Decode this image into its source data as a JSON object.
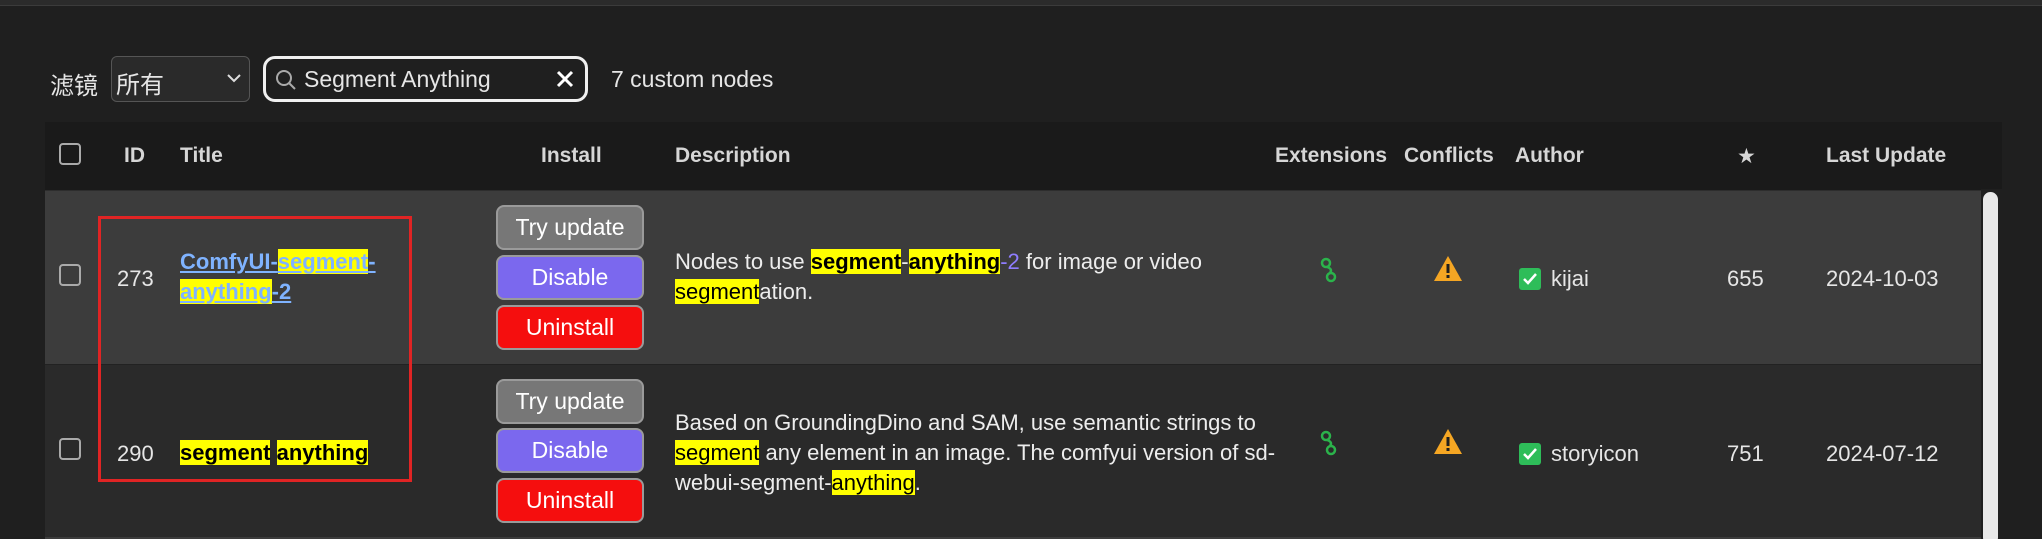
{
  "filter": {
    "label": "滤镜",
    "selected": "所有",
    "search_value": "Segment Anything",
    "count_text": "7 custom nodes"
  },
  "headers": {
    "id": "ID",
    "title": "Title",
    "install": "Install",
    "description": "Description",
    "extensions": "Extensions",
    "conflicts": "Conflicts",
    "author": "Author",
    "stars": "★",
    "last_update": "Last Update"
  },
  "rows": [
    {
      "id": "273",
      "title_parts": [
        "ComfyUI-",
        "segment",
        "-",
        "anything",
        "-2"
      ],
      "buttons": [
        "Try update",
        "Disable",
        "Uninstall"
      ],
      "description": "Nodes to use segment-anything-2 for image or video segmentation.",
      "author": "kijai",
      "stars": "655",
      "last_update": "2024-10-03"
    },
    {
      "id": "290",
      "title_parts": [
        "segment",
        " ",
        "anything"
      ],
      "buttons": [
        "Try update",
        "Disable",
        "Uninstall"
      ],
      "description": "Based on GroundingDino and SAM, use semantic strings to segment any element in an image. The comfyui version of sd-webui-segment-anything.",
      "author": "storyicon",
      "stars": "751",
      "last_update": "2024-07-12"
    }
  ],
  "icons": {
    "search": "search-icon",
    "clear": "close-icon",
    "extensions": "extension-link-icon",
    "conflicts": "warning-icon",
    "verified": "checkbox-checked-icon"
  },
  "colors": {
    "highlight": "#ffff00",
    "disable_button": "#7b68ee",
    "uninstall_button": "#f50e0e",
    "try_update_button": "#777777",
    "warning": "#f5a623",
    "extension": "#2bb34b",
    "verified": "#2ebd59"
  }
}
